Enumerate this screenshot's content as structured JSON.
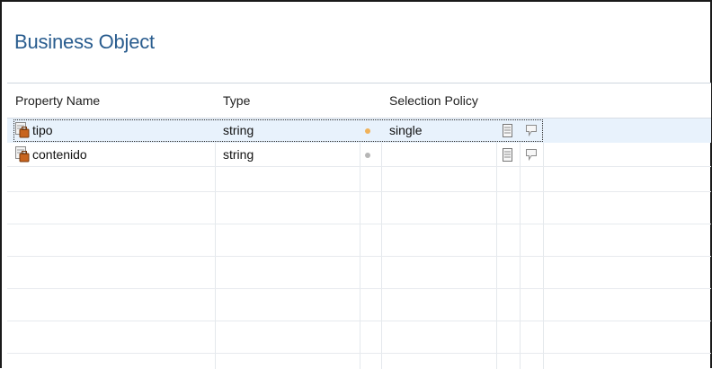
{
  "panel": {
    "title": "Business Object"
  },
  "table": {
    "columns": [
      "Property Name",
      "Type",
      "",
      "Selection Policy",
      "",
      ""
    ],
    "rows": [
      {
        "name": "tipo",
        "type": "string",
        "status": "orange",
        "selection_policy": "single",
        "selected": true
      },
      {
        "name": "contenido",
        "type": "string",
        "status": "gray",
        "selection_policy": "",
        "selected": false
      }
    ]
  },
  "colors": {
    "title": "#2a5d8f",
    "selected_row": "#e8f2fc",
    "status_orange": "#f0b25a",
    "status_gray": "#b6b6b6"
  },
  "icons": {
    "property": "business-property-icon",
    "documentation": "document-icon",
    "comment": "speech-bubble-icon"
  }
}
